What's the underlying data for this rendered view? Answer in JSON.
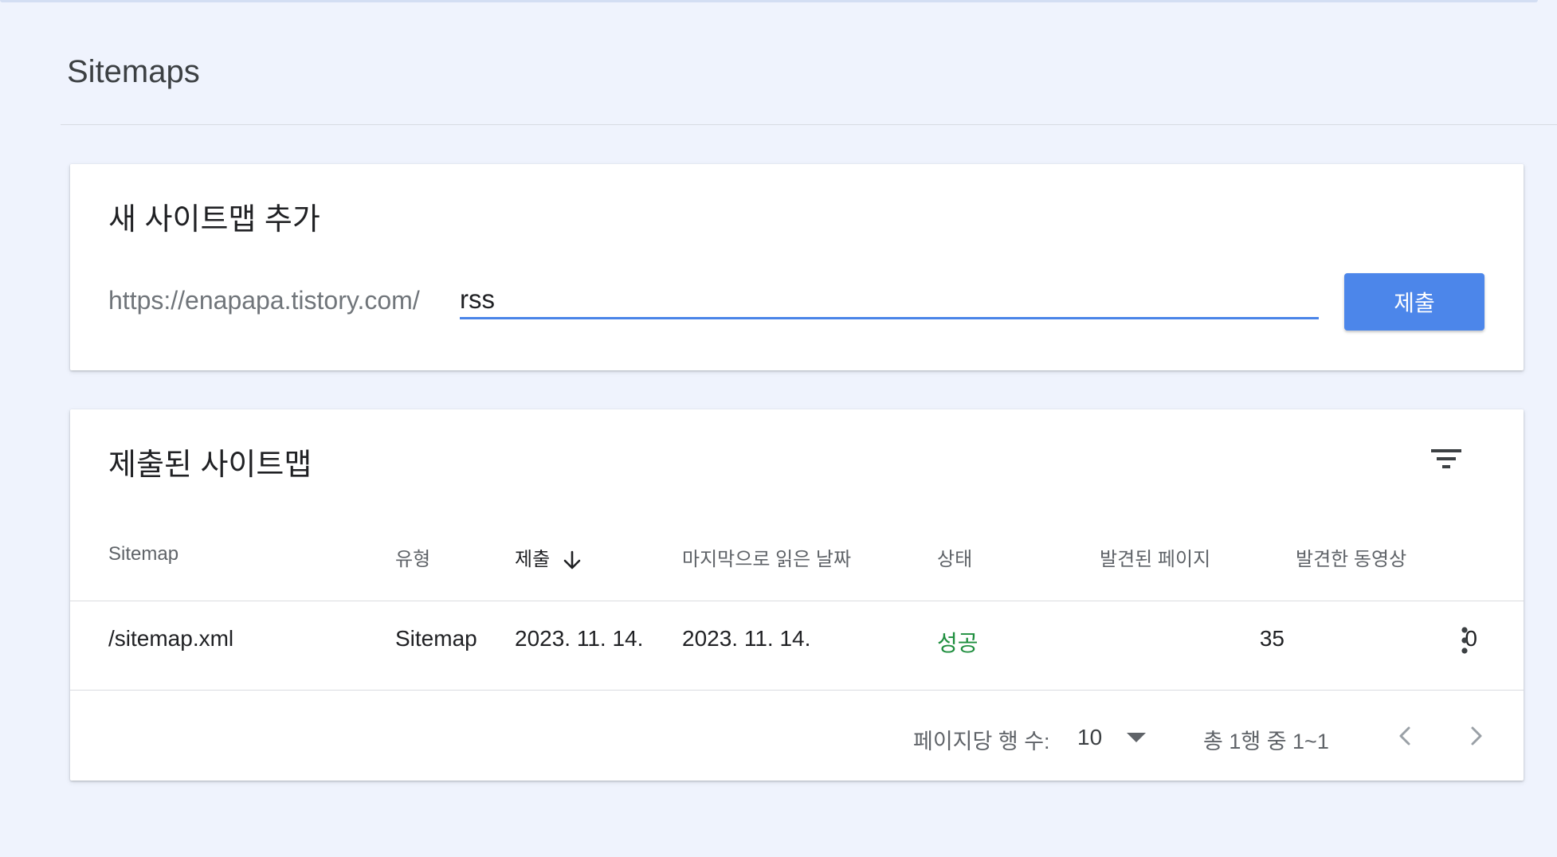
{
  "page": {
    "title": "Sitemaps"
  },
  "add_card": {
    "heading": "새 사이트맵 추가",
    "url_prefix": "https://enapapa.tistory.com/",
    "input_value": "rss",
    "submit_label": "제출"
  },
  "list_card": {
    "heading": "제출된 사이트맵",
    "columns": {
      "sitemap": "Sitemap",
      "type": "유형",
      "submitted": "제출",
      "last_read": "마지막으로 읽은 날짜",
      "status": "상태",
      "pages_found": "발견된 페이지",
      "videos_found": "발견한 동영상"
    },
    "rows": [
      {
        "sitemap": "/sitemap.xml",
        "type": "Sitemap",
        "submitted": "2023. 11. 14.",
        "last_read": "2023. 11. 14.",
        "status": "성공",
        "pages_found": "35",
        "videos_found": "0"
      }
    ],
    "pagination": {
      "rows_per_page_label": "페이지당 행 수:",
      "rows_per_page_value": "10",
      "range_text": "총 1행 중 1~1"
    }
  },
  "colors": {
    "background": "#eff3fd",
    "accent": "#4c86ea",
    "success": "#1e8e3e"
  },
  "icons": {
    "filter": "filter-icon",
    "sort": "arrow-down-icon",
    "row_menu": "more-vert-icon",
    "dropdown": "dropdown-arrow-icon",
    "prev": "chevron-left-icon",
    "next": "chevron-right-icon"
  }
}
